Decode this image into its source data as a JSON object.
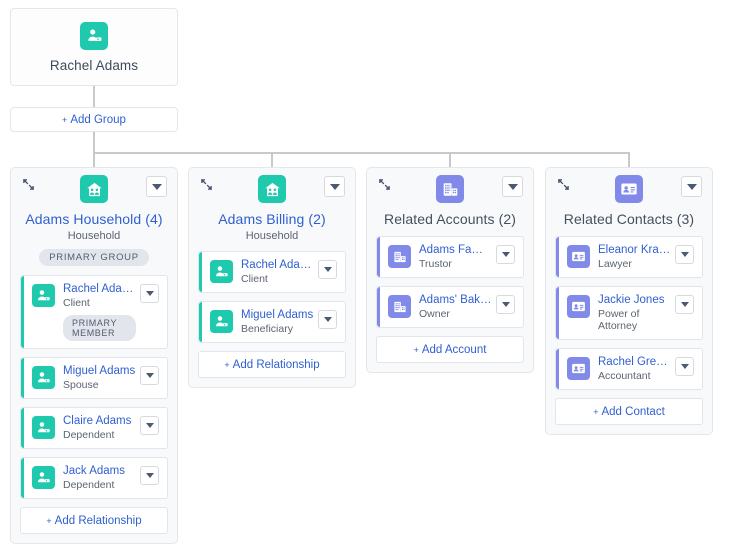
{
  "root": {
    "name": "Rachel Adams",
    "icon": "person-card-icon",
    "icon_color": "#1fc9ae"
  },
  "add_group": {
    "label": "Add Group",
    "plus": "+"
  },
  "colors": {
    "teal": "#1fc9ae",
    "purple": "#818ae8",
    "link": "#2f5fd0",
    "line": "#c9c9c9",
    "card_bg": "#f8f9fb"
  },
  "groups": [
    {
      "id": "adams-household",
      "title": "Adams Household (4)",
      "title_style": "link",
      "subtitle": "Household",
      "badge": "PRIMARY GROUP",
      "icon": "household-icon",
      "accent": "#1fc9ae",
      "members": [
        {
          "name": "Rachel Adams",
          "role": "Client",
          "icon": "person-card-icon",
          "badge": "PRIMARY MEMBER",
          "truncated": false
        },
        {
          "name": "Miguel Adams",
          "role": "Spouse",
          "icon": "person-card-icon",
          "badge": "",
          "truncated": false
        },
        {
          "name": "Claire Adams",
          "role": "Dependent",
          "icon": "person-card-icon",
          "badge": "",
          "truncated": false
        },
        {
          "name": "Jack Adams",
          "role": "Dependent",
          "icon": "person-card-icon",
          "badge": "",
          "truncated": false
        }
      ],
      "add_label": "Add Relationship"
    },
    {
      "id": "adams-billing",
      "title": "Adams Billing (2)",
      "title_style": "link",
      "subtitle": "Household",
      "badge": "",
      "icon": "household-icon",
      "accent": "#1fc9ae",
      "members": [
        {
          "name": "Rachel Adams",
          "role": "Client",
          "icon": "person-card-icon",
          "badge": "",
          "truncated": false
        },
        {
          "name": "Miguel Adams",
          "role": "Beneficiary",
          "icon": "person-card-icon",
          "badge": "",
          "truncated": false
        }
      ],
      "add_label": "Add Relationship"
    },
    {
      "id": "related-accounts",
      "title": "Related Accounts (2)",
      "title_style": "plain",
      "subtitle": "",
      "badge": "",
      "icon": "building-icon",
      "accent": "#818ae8",
      "members": [
        {
          "name": "Adams Family T...",
          "role": "Trustor",
          "icon": "building-icon",
          "badge": "",
          "truncated": true
        },
        {
          "name": "Adams' Bakery",
          "role": "Owner",
          "icon": "building-icon",
          "badge": "",
          "truncated": false
        }
      ],
      "add_label": "Add Account"
    },
    {
      "id": "related-contacts",
      "title": "Related Contacts (3)",
      "title_style": "plain",
      "subtitle": "",
      "badge": "",
      "icon": "contact-card-icon",
      "accent": "#818ae8",
      "members": [
        {
          "name": "Eleanor Kravitz",
          "role": "Lawyer",
          "icon": "contact-card-icon",
          "badge": "",
          "truncated": false
        },
        {
          "name": "Jackie Jones",
          "role": "Power of Attorney",
          "icon": "contact-card-icon",
          "badge": "",
          "truncated": false
        },
        {
          "name": "Rachel Greenfi...",
          "role": "Accountant",
          "icon": "contact-card-icon",
          "badge": "",
          "truncated": true
        }
      ],
      "add_label": "Add Contact"
    }
  ]
}
